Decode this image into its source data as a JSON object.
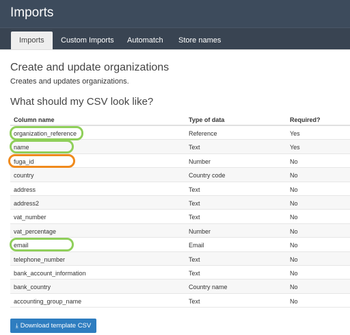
{
  "header": {
    "title": "Imports"
  },
  "tabs": [
    {
      "label": "Imports",
      "active": true
    },
    {
      "label": "Custom Imports",
      "active": false
    },
    {
      "label": "Automatch",
      "active": false
    },
    {
      "label": "Store names",
      "active": false
    }
  ],
  "page": {
    "heading": "Create and update organizations",
    "description": "Creates and updates organizations.",
    "csv_heading": "What should my CSV look like?"
  },
  "table": {
    "columns": [
      "Column name",
      "Type of data",
      "Required?"
    ],
    "rows": [
      {
        "name": "organization_reference",
        "type": "Reference",
        "required": "Yes"
      },
      {
        "name": "name",
        "type": "Text",
        "required": "Yes"
      },
      {
        "name": "fuga_id",
        "type": "Number",
        "required": "No"
      },
      {
        "name": "country",
        "type": "Country code",
        "required": "No"
      },
      {
        "name": "address",
        "type": "Text",
        "required": "No"
      },
      {
        "name": "address2",
        "type": "Text",
        "required": "No"
      },
      {
        "name": "vat_number",
        "type": "Text",
        "required": "No"
      },
      {
        "name": "vat_percentage",
        "type": "Number",
        "required": "No"
      },
      {
        "name": "email",
        "type": "Email",
        "required": "No"
      },
      {
        "name": "telephone_number",
        "type": "Text",
        "required": "No"
      },
      {
        "name": "bank_account_information",
        "type": "Text",
        "required": "No"
      },
      {
        "name": "bank_country",
        "type": "Country name",
        "required": "No"
      },
      {
        "name": "accounting_group_name",
        "type": "Text",
        "required": "No"
      }
    ]
  },
  "download": {
    "label": "Download template CSV",
    "icon": "download-icon"
  },
  "colors": {
    "topbar": "#3d4b5c",
    "tabbar": "#394452",
    "button": "#2e7dc0",
    "highlight_green": "#8fcf5a",
    "highlight_orange": "#f08a1c"
  }
}
